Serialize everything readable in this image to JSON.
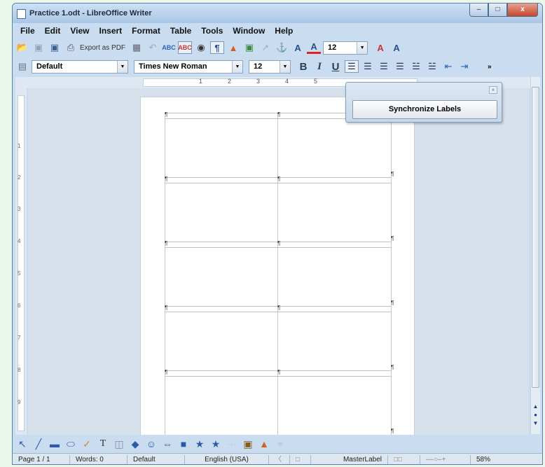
{
  "window": {
    "title": "Practice 1.odt - LibreOffice Writer",
    "controls": {
      "minimize": "–",
      "maximize": "□",
      "close": "x"
    }
  },
  "menubar": [
    "File",
    "Edit",
    "View",
    "Insert",
    "Format",
    "Table",
    "Tools",
    "Window",
    "Help"
  ],
  "toolbar1": {
    "export_pdf_label": "Export as PDF",
    "font_size_small": "12",
    "icons": [
      "open-icon",
      "save-icon",
      "export-icon",
      "print-icon",
      "spellcheck-icon",
      "find-icon",
      "formatting-marks-icon",
      "navigator-icon",
      "image-icon",
      "anchor-icon",
      "font-color-icon",
      "highlight-icon"
    ]
  },
  "toolbar2": {
    "paragraph_style": "Default",
    "font_name": "Times New Roman",
    "font_size": "12",
    "bold": "B",
    "italic": "I",
    "underline": "U",
    "overflow": "»"
  },
  "ruler": {
    "h_numbers": [
      "1",
      "2",
      "3",
      "4",
      "5"
    ],
    "v_numbers": [
      "1",
      "2",
      "3",
      "4",
      "5",
      "6",
      "7",
      "8",
      "9"
    ]
  },
  "sync_dialog": {
    "button_label": "Synchronize Labels"
  },
  "statusbar": {
    "page": "Page 1 / 1",
    "words": "Words: 0",
    "style": "Default",
    "language": "English (USA)",
    "label": "MasterLabel",
    "zoom": "58%"
  },
  "accent_colors": {
    "titlebar": "#a9c6e6",
    "close": "#c7462c"
  }
}
